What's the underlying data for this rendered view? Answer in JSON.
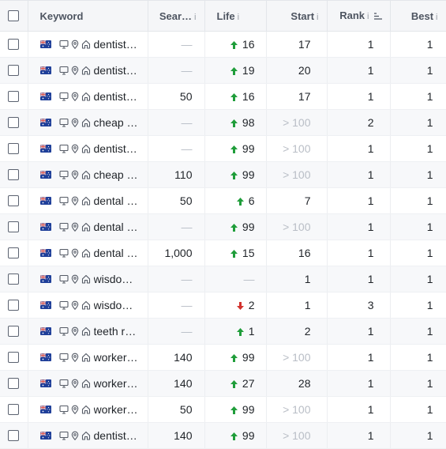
{
  "columns": {
    "keyword": "Keyword",
    "search_volume": "Sear…",
    "life": "Life",
    "start": "Start",
    "rank": "Rank",
    "best": "Best"
  },
  "colors": {
    "up": "#1f9d3a",
    "down": "#d2322d",
    "muted": "#b9bec6"
  },
  "icons": [
    "flag-australia-icon",
    "desktop-icon",
    "location-pin-icon",
    "home-icon"
  ],
  "rows": [
    {
      "keyword": "dentist…",
      "sv": "—",
      "dir": "up",
      "life": "16",
      "start": "17",
      "rank": "1",
      "best": "1"
    },
    {
      "keyword": "dentist…",
      "sv": "—",
      "dir": "up",
      "life": "19",
      "start": "20",
      "rank": "1",
      "best": "1"
    },
    {
      "keyword": "dentist…",
      "sv": "50",
      "dir": "up",
      "life": "16",
      "start": "17",
      "rank": "1",
      "best": "1"
    },
    {
      "keyword": "cheap i…",
      "sv": "—",
      "dir": "up",
      "life": "98",
      "start": "> 100",
      "rank": "2",
      "best": "1"
    },
    {
      "keyword": "dentist…",
      "sv": "—",
      "dir": "up",
      "life": "99",
      "start": "> 100",
      "rank": "1",
      "best": "1"
    },
    {
      "keyword": "cheap …",
      "sv": "110",
      "dir": "up",
      "life": "99",
      "start": "> 100",
      "rank": "1",
      "best": "1"
    },
    {
      "keyword": "dental i…",
      "sv": "50",
      "dir": "up",
      "life": "6",
      "start": "7",
      "rank": "1",
      "best": "1"
    },
    {
      "keyword": "dental i…",
      "sv": "—",
      "dir": "up",
      "life": "99",
      "start": "> 100",
      "rank": "1",
      "best": "1"
    },
    {
      "keyword": "dental i…",
      "sv": "1,000",
      "dir": "up",
      "life": "15",
      "start": "16",
      "rank": "1",
      "best": "1"
    },
    {
      "keyword": "wisdo…",
      "sv": "—",
      "dir": "none",
      "life": "—",
      "start": "1",
      "rank": "1",
      "best": "1"
    },
    {
      "keyword": "wisdo…",
      "sv": "—",
      "dir": "down",
      "life": "2",
      "start": "1",
      "rank": "3",
      "best": "1"
    },
    {
      "keyword": "teeth r…",
      "sv": "—",
      "dir": "up",
      "life": "1",
      "start": "2",
      "rank": "1",
      "best": "1"
    },
    {
      "keyword": "worker…",
      "sv": "140",
      "dir": "up",
      "life": "99",
      "start": "> 100",
      "rank": "1",
      "best": "1"
    },
    {
      "keyword": "worker…",
      "sv": "140",
      "dir": "up",
      "life": "27",
      "start": "28",
      "rank": "1",
      "best": "1"
    },
    {
      "keyword": "worker…",
      "sv": "50",
      "dir": "up",
      "life": "99",
      "start": "> 100",
      "rank": "1",
      "best": "1"
    },
    {
      "keyword": "dentist…",
      "sv": "140",
      "dir": "up",
      "life": "99",
      "start": "> 100",
      "rank": "1",
      "best": "1"
    }
  ]
}
